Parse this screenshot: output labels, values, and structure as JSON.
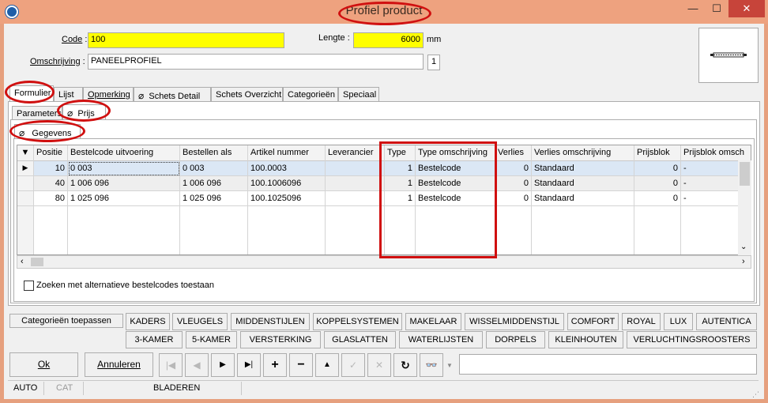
{
  "window": {
    "title": "Profiel product",
    "minimize": "—",
    "maximize": "☐",
    "close": "✕"
  },
  "form": {
    "code_label": "Code",
    "code_value": "100",
    "lengte_label": "Lengte",
    "lengte_value": "6000",
    "lengte_unit": "mm",
    "omschrijving_label": "Omschrijving",
    "omschrijving_value": "PANEELPROFIEL",
    "count": "1"
  },
  "tabs": [
    "Formulier",
    "Lijst",
    "Opmerking",
    "Schets Detail",
    "Schets Overzicht",
    "Categorieën",
    "Speciaal"
  ],
  "subtabs": [
    "Parameters",
    "Prijs"
  ],
  "section_tab": "Gegevens",
  "grid": {
    "columns": [
      "Positie",
      "Bestelcode uitvoering",
      "Bestellen als",
      "Artikel nummer",
      "Leverancier",
      "Type",
      "Type omschrijving",
      "Verlies",
      "Verlies omschrijving",
      "Prijsblok",
      "Prijsblok omsch"
    ],
    "rows": [
      [
        "10",
        "0 003",
        "0 003",
        "100.0003",
        "",
        "1",
        "Bestelcode",
        "0",
        "Standaard",
        "0",
        "-"
      ],
      [
        "40",
        "1 006 096",
        "1 006 096",
        "100.1006096",
        "",
        "1",
        "Bestelcode",
        "0",
        "Standaard",
        "0",
        "-"
      ],
      [
        "80",
        "1 025 096",
        "1 025 096",
        "100.1025096",
        "",
        "1",
        "Bestelcode",
        "0",
        "Standaard",
        "0",
        "-"
      ]
    ]
  },
  "checkbox_label": "Zoeken met alternatieve bestelcodes toestaan",
  "categorie_button": "Categorieën toepassen",
  "category_row1": [
    "KADERS",
    "VLEUGELS",
    "MIDDENSTIJLEN",
    "KOPPELSYSTEMEN",
    "MAKELAAR",
    "WISSELMIDDENSTIJL",
    "COMFORT",
    "ROYAL",
    "LUX",
    "AUTENTICA"
  ],
  "category_row2": [
    "3-KAMER",
    "5-KAMER",
    "VERSTERKING",
    "GLASLATTEN",
    "WATERLIJSTEN",
    "DORPELS",
    "KLEINHOUTEN",
    "VERLUCHTINGSROOSTERS"
  ],
  "buttons": {
    "ok": "Ok",
    "annuleren": "Annuleren"
  },
  "status": {
    "mode1": "AUTO",
    "mode2": "CAT",
    "mode3": "BLADEREN"
  }
}
